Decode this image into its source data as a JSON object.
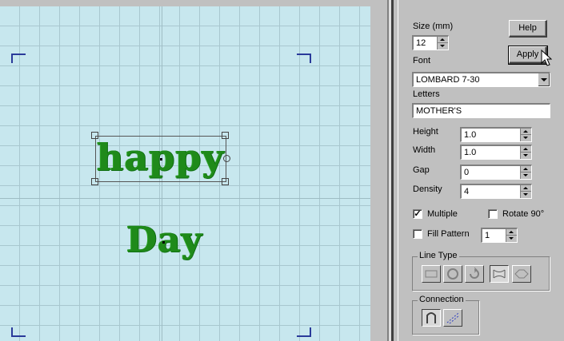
{
  "canvas": {
    "words": [
      "happy",
      "Day"
    ]
  },
  "panel": {
    "size_label": "Size (mm)",
    "size_value": "12",
    "help_label": "Help",
    "apply_label": "Apply",
    "font_label": "Font",
    "font_value": "LOMBARD 7-30",
    "letters_label": "Letters",
    "letters_value": "MOTHER'S",
    "height_label": "Height",
    "height_value": "1.0",
    "width_label": "Width",
    "width_value": "1.0",
    "gap_label": "Gap",
    "gap_value": "0",
    "density_label": "Density",
    "density_value": "4",
    "multiple_label": "Multiple",
    "multiple_checked": true,
    "rotate_label": "Rotate 90°",
    "rotate_checked": false,
    "fill_pattern_label": "Fill Pattern",
    "fill_pattern_checked": false,
    "fill_pattern_value": "1",
    "line_type_title": "Line Type",
    "line_type_icons": [
      "line-flat-icon",
      "line-circle-icon",
      "line-rotate-icon",
      "line-arch-icon",
      "line-diamond-icon"
    ],
    "connection_title": "Connection",
    "connection_icons": [
      "connection-loop-icon",
      "connection-diagonal-icon"
    ]
  },
  "colors": {
    "canvas_bg": "#c7e7ee",
    "grid": "#a8c7cf",
    "embroidery_green": "#1f8a1a",
    "corner_marks": "#2a3a9a",
    "panel_bg": "#c0c0c0"
  }
}
